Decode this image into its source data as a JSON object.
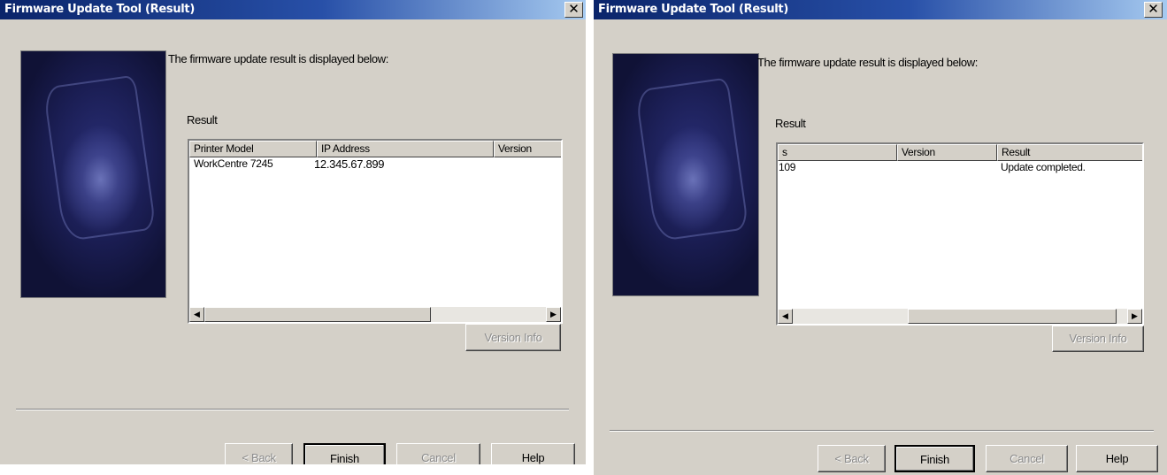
{
  "dialogs": [
    {
      "title": "Firmware Update Tool (Result)",
      "close_glyph": "✕",
      "intro": "The firmware update result is displayed below:",
      "result_label": "Result",
      "columns": [
        "Printer Model",
        "IP Address",
        "Version"
      ],
      "rows": [
        [
          "WorkCentre 7245",
          "12.345.67.899",
          ""
        ]
      ],
      "scroll_left": "◀",
      "scroll_right": "▶",
      "version_info": "Version Info",
      "buttons": {
        "back": "< Back",
        "finish": "Finish",
        "cancel": "Cancel",
        "help": "Help"
      }
    },
    {
      "title": "Firmware Update Tool (Result)",
      "close_glyph": "✕",
      "intro": "The firmware update result is displayed below:",
      "result_label": "Result",
      "columns": [
        "s",
        "Version",
        "Result"
      ],
      "rows": [
        [
          "109",
          "",
          "Update completed."
        ]
      ],
      "scroll_left": "◀",
      "scroll_right": "▶",
      "version_info": "Version Info",
      "buttons": {
        "back": "< Back",
        "finish": "Finish",
        "cancel": "Cancel",
        "help": "Help"
      }
    }
  ],
  "icons": {
    "close": "close-icon",
    "scroll_left": "chevron-left-icon",
    "scroll_right": "chevron-right-icon"
  },
  "colors": {
    "dialog_bg": "#d4d0c8",
    "titlebar_start": "#0a246a",
    "titlebar_end": "#a6caf0"
  }
}
